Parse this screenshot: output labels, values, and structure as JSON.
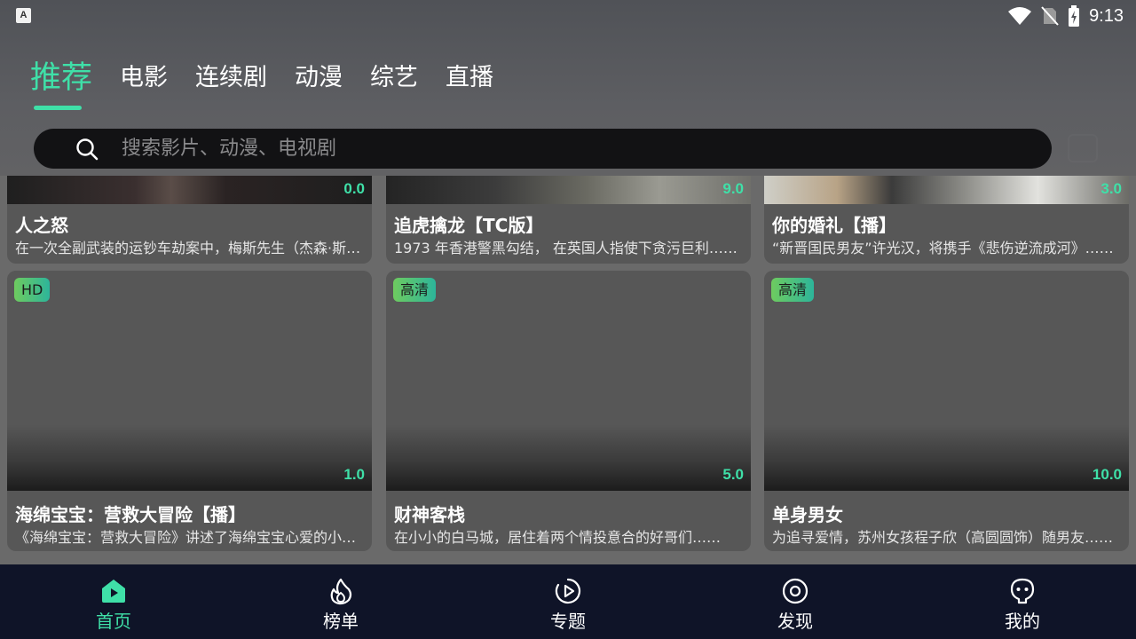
{
  "status_bar": {
    "app_icon_letter": "A",
    "time": "9:13"
  },
  "tabs": [
    {
      "label": "推荐",
      "active": true
    },
    {
      "label": "电影",
      "active": false
    },
    {
      "label": "连续剧",
      "active": false
    },
    {
      "label": "动漫",
      "active": false
    },
    {
      "label": "综艺",
      "active": false
    },
    {
      "label": "直播",
      "active": false
    }
  ],
  "search": {
    "placeholder": "搜索影片、动漫、电视剧"
  },
  "cards_row1": [
    {
      "score": "0.0",
      "title": "人之怒",
      "desc": "在一次全副武装的运钞车劫案中，梅斯先生（杰森·斯坦森 饰）……"
    },
    {
      "score": "9.0",
      "title": "追虎擒龙【TC版】",
      "desc": "1973 年香港警黑勾结， 在英国人指使下贪污巨利……"
    },
    {
      "score": "3.0",
      "title": "你的婚礼【播】",
      "desc": "“新晋国民男友”许光汉，将携手《悲伤逆流成河》……"
    }
  ],
  "cards_row2": [
    {
      "badge": "HD",
      "score": "1.0",
      "title": "海绵宝宝：营救大冒险【播】",
      "desc": "《海绵宝宝：营救大冒险》讲述了海绵宝宝心爱的小蜗……"
    },
    {
      "badge": "高清",
      "score": "5.0",
      "title": "财神客栈",
      "desc": "在小小的白马城，居住着两个情投意合的好哥们……"
    },
    {
      "badge": "高清",
      "score": "10.0",
      "title": "单身男女",
      "desc": "为追寻爱情，苏州女孩程子欣（高圆圆饰）随男友……"
    }
  ],
  "bottom_nav": [
    {
      "label": "首页",
      "icon": "home-icon",
      "active": true
    },
    {
      "label": "榜单",
      "icon": "flame-icon",
      "active": false
    },
    {
      "label": "专题",
      "icon": "play-circle-icon",
      "active": false
    },
    {
      "label": "发现",
      "icon": "target-icon",
      "active": false
    },
    {
      "label": "我的",
      "icon": "alien-icon",
      "active": false
    }
  ],
  "colors": {
    "accent": "#3fe0a8",
    "nav_bg": "#0f1428",
    "search_bg": "#121214"
  }
}
